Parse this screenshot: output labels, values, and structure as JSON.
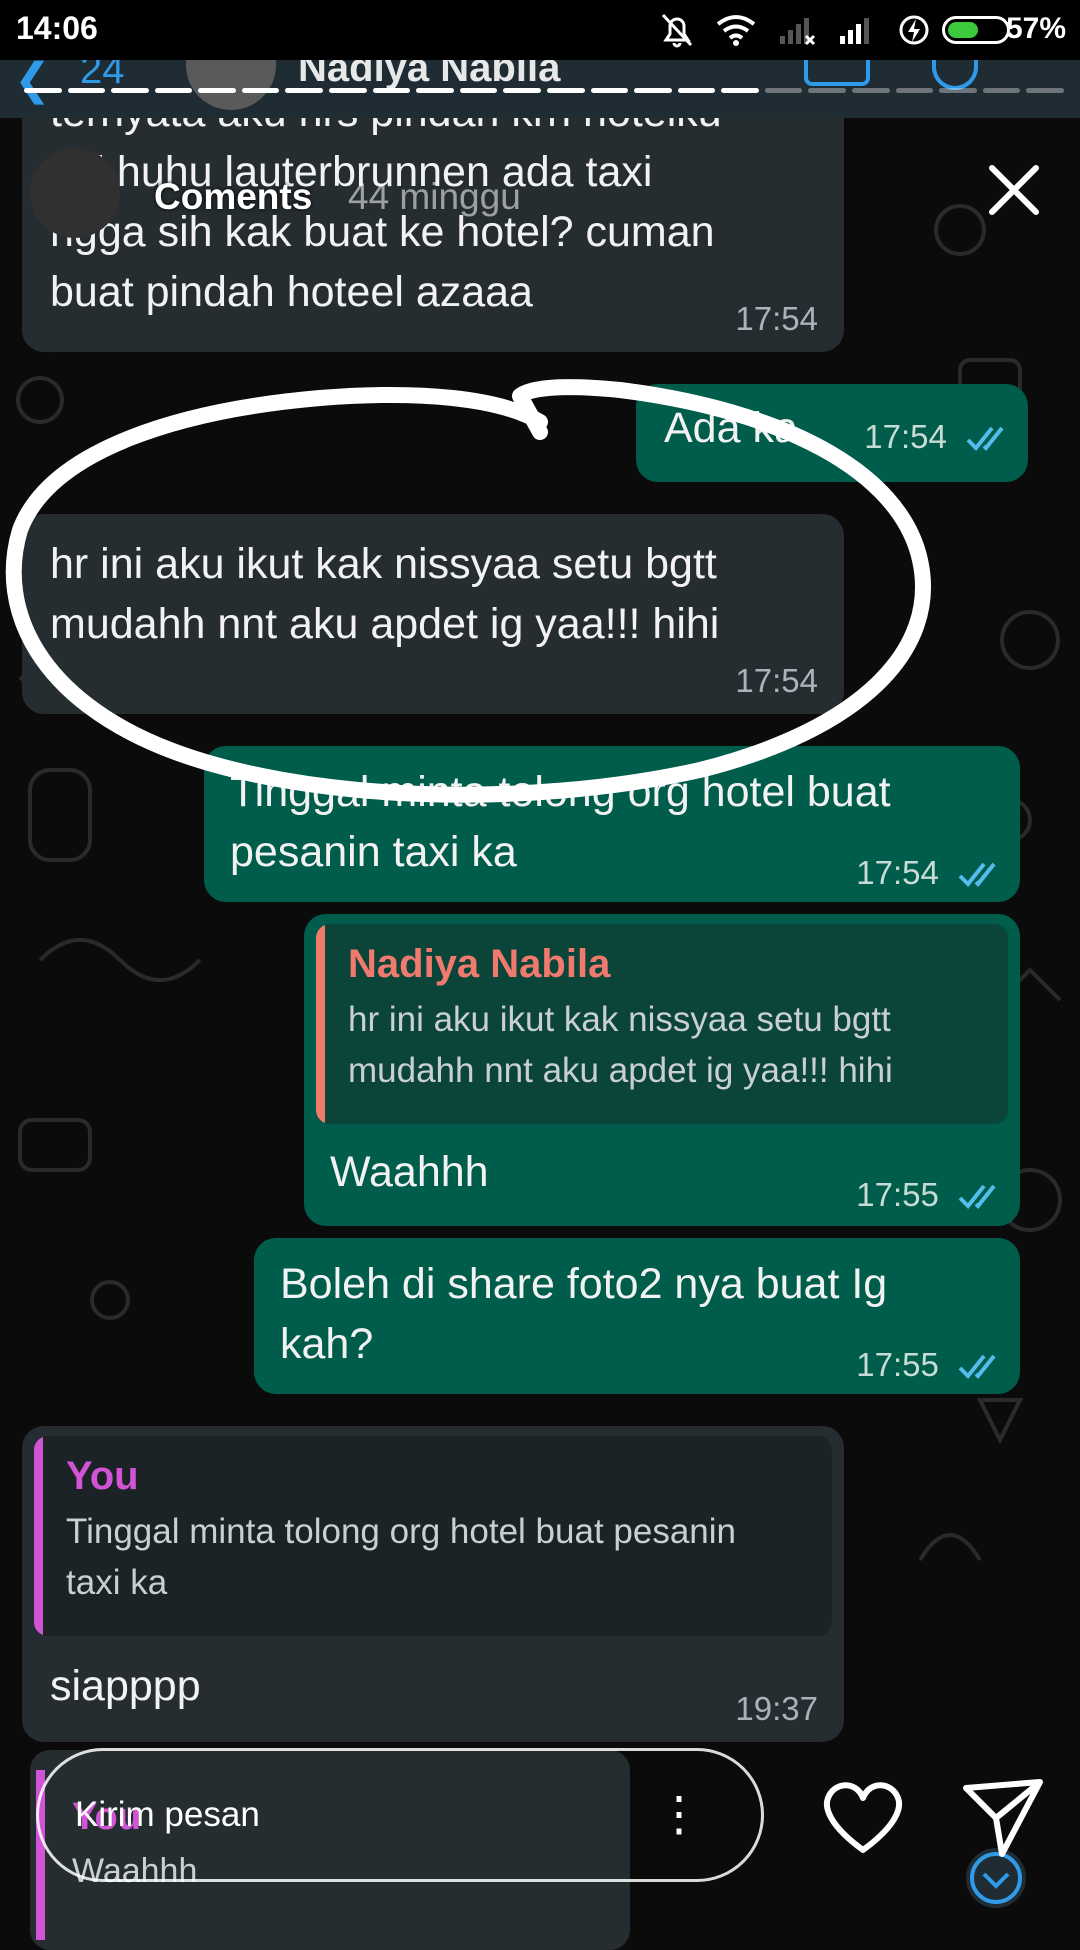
{
  "status_bar": {
    "time": "14:06",
    "battery_percent": "57%",
    "battery_level": 0.57
  },
  "chat_header": {
    "back_count": "24",
    "contact_name": "Nadiya Nabila"
  },
  "story": {
    "username": "Coments",
    "posted_ago": "44 minggu",
    "progress_segments_done": 17,
    "progress_segments_total": 24
  },
  "messages": [
    {
      "id": "m1",
      "direction": "in",
      "text": "ternyata aku hrs pindah krn hotelku\nfull huhu lauterbrunnen ada taxi\nngga sih kak buat ke hotel? cuman\nbuat pindah hoteel azaaa",
      "time": "17:54"
    },
    {
      "id": "m2",
      "direction": "out",
      "text": "Ada ka",
      "time": "17:54"
    },
    {
      "id": "m3",
      "direction": "in",
      "text": "hr ini aku ikut kak nissyaa setu bgtt\nmudahh nnt aku apdet ig yaa!!! hihi",
      "time": "17:54"
    },
    {
      "id": "m4",
      "direction": "out",
      "text": "Tinggal minta tolong org hotel buat\npesanin taxi ka",
      "time": "17:54"
    },
    {
      "id": "m5",
      "direction": "out",
      "quote_name": "Nadiya Nabila",
      "quote_text": "hr ini aku ikut kak nissyaa setu bgtt\nmudahh nnt aku apdet ig yaa!!! hihi",
      "text": "Waahhh",
      "time": "17:55"
    },
    {
      "id": "m6",
      "direction": "out",
      "text": "Boleh di share foto2 nya buat Ig\nkah?",
      "time": "17:55"
    },
    {
      "id": "m7",
      "direction": "in",
      "quote_name": "You",
      "quote_text": "Tinggal minta tolong org hotel buat pesanin\ntaxi ka",
      "text": "siapppp",
      "time": "19:37"
    },
    {
      "id": "m8",
      "direction": "in",
      "quote_name": "You",
      "quote_text": "Waahhh"
    }
  ],
  "reply": {
    "placeholder": "Kirim pesan"
  },
  "icons": {
    "close": "close-icon",
    "heart": "heart-icon",
    "send": "send-icon",
    "more": "more-vertical-icon",
    "ticks": "double-check-icon",
    "scroll": "chevron-down-icon"
  },
  "colors": {
    "incoming_bubble": "#262d31",
    "outgoing_bubble": "#005c4b",
    "read_ticks": "#53bdeb",
    "quote_bar_contact": "#f07a6e",
    "quote_bar_you": "#d154d6",
    "scribble": "#ffffff"
  }
}
